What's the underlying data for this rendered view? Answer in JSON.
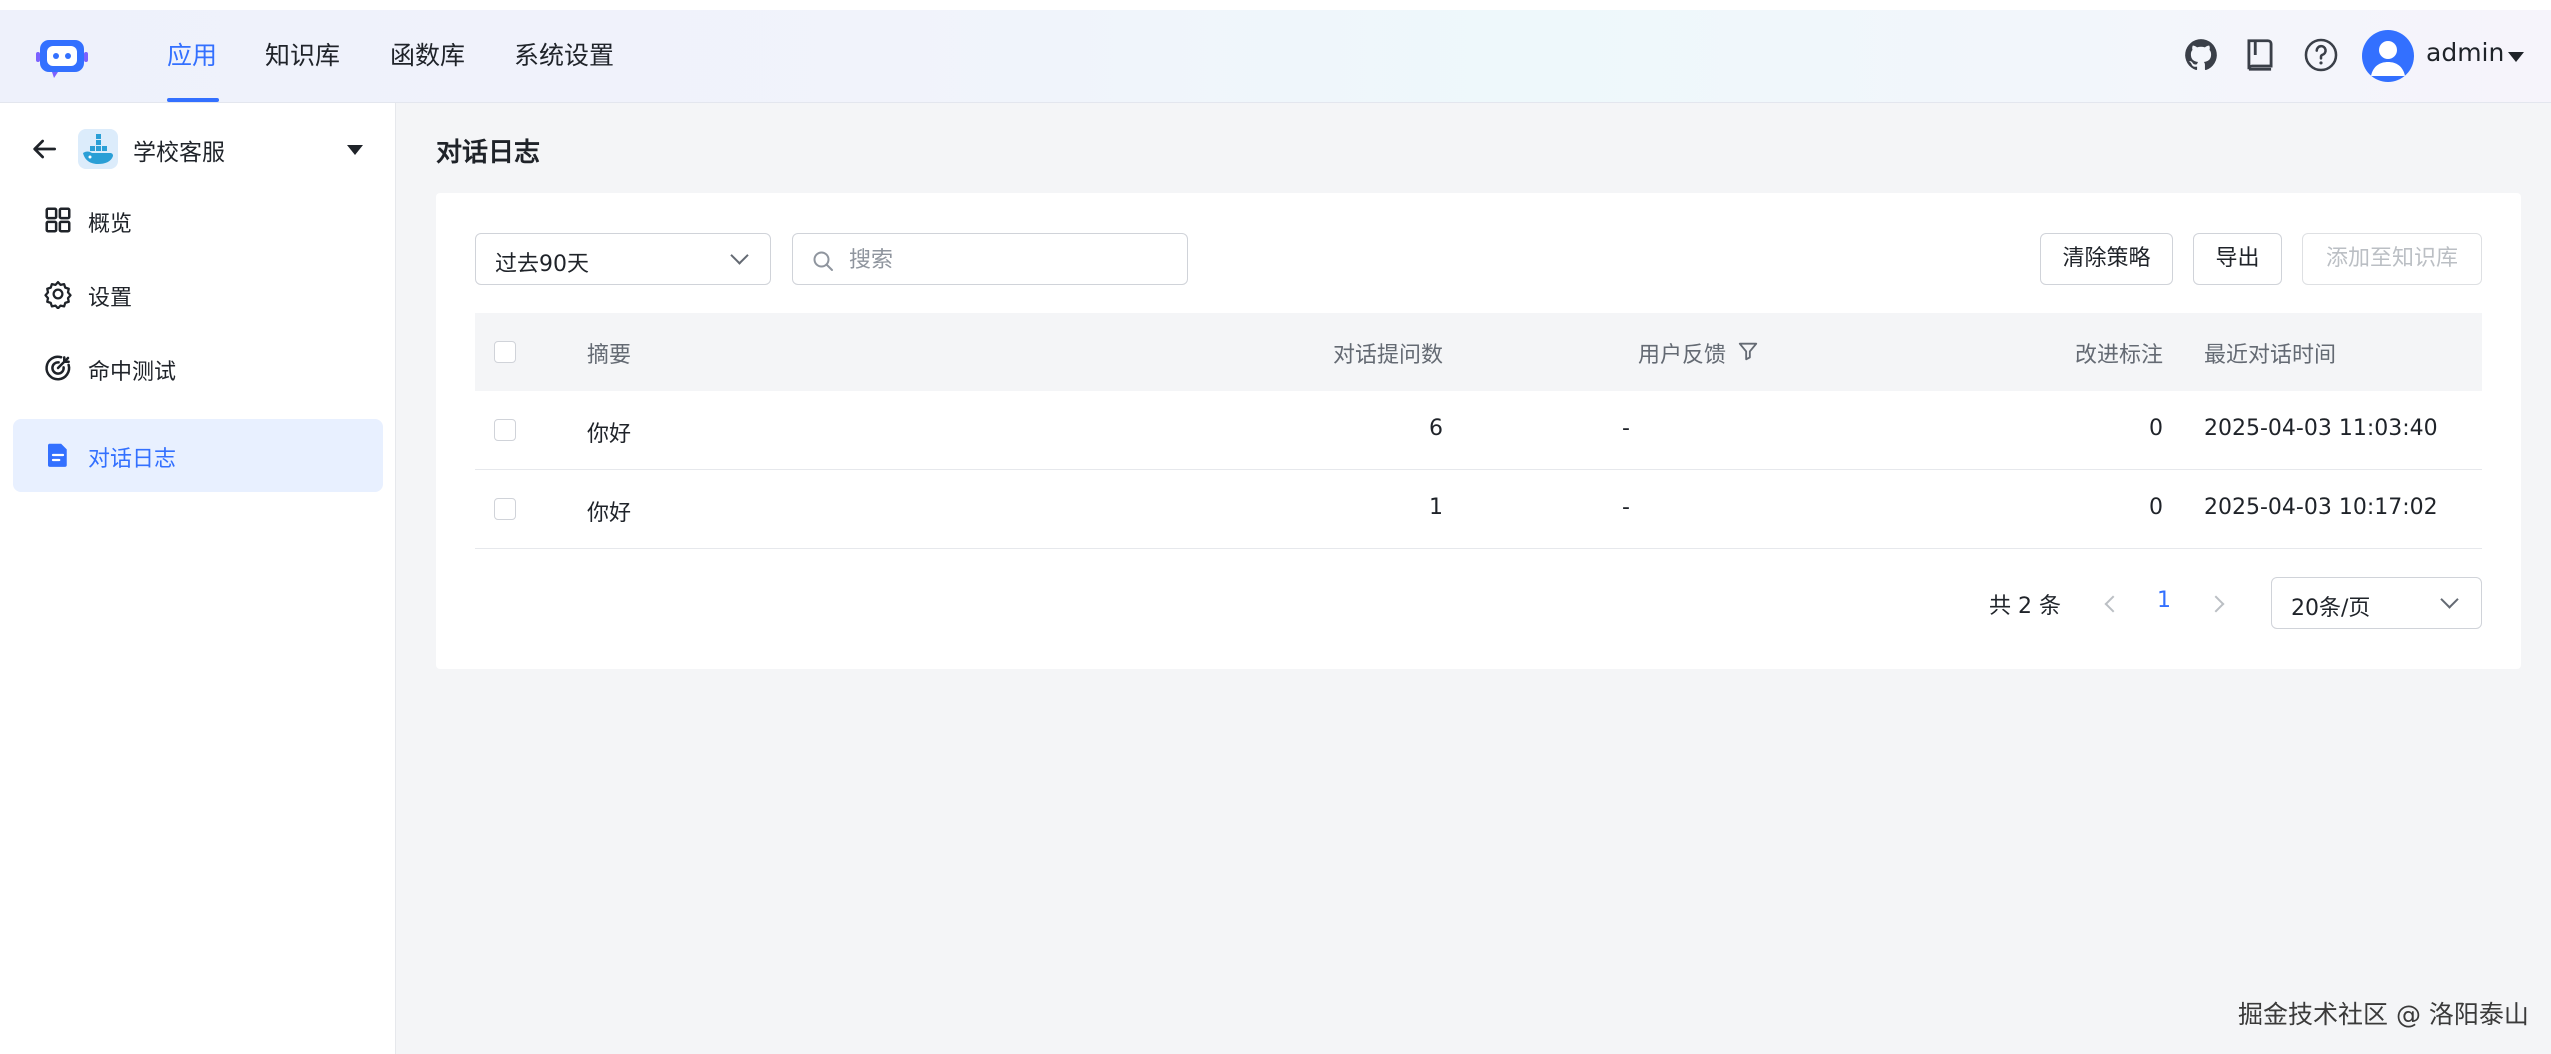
{
  "header": {
    "nav": [
      {
        "label": "应用",
        "active": true
      },
      {
        "label": "知识库",
        "active": false
      },
      {
        "label": "函数库",
        "active": false
      },
      {
        "label": "系统设置",
        "active": false
      }
    ],
    "icons": [
      "github-icon",
      "book-icon",
      "help-icon"
    ],
    "username": "admin"
  },
  "sidebar": {
    "app_name": "学校客服",
    "items": [
      {
        "label": "概览",
        "icon": "grid-icon",
        "active": false
      },
      {
        "label": "设置",
        "icon": "gear-icon",
        "active": false
      },
      {
        "label": "命中测试",
        "icon": "target-icon",
        "active": false
      },
      {
        "label": "对话日志",
        "icon": "document-icon",
        "active": true
      }
    ]
  },
  "main": {
    "title": "对话日志",
    "filter": {
      "range": "过去90天"
    },
    "search": {
      "placeholder": "搜索",
      "value": ""
    },
    "buttons": {
      "clear_policy": "清除策略",
      "export": "导出",
      "add_to_kb": "添加至知识库"
    },
    "table": {
      "columns": [
        "摘要",
        "对话提问数",
        "用户反馈",
        "改进标注",
        "最近对话时间"
      ],
      "rows": [
        {
          "summary": "你好",
          "questions": "6",
          "feedback": "-",
          "improvements": "0",
          "last_time": "2025-04-03 11:03:40"
        },
        {
          "summary": "你好",
          "questions": "1",
          "feedback": "-",
          "improvements": "0",
          "last_time": "2025-04-03 10:17:02"
        }
      ]
    },
    "pagination": {
      "total": "共 2 条",
      "current_page": "1",
      "page_size": "20条/页"
    }
  },
  "watermark": "掘金技术社区 @ 洛阳泰山",
  "colors": {
    "accent": "#3370ff",
    "sidebar_active_bg": "#e8f0ff",
    "page_bg": "#f4f5f7"
  }
}
